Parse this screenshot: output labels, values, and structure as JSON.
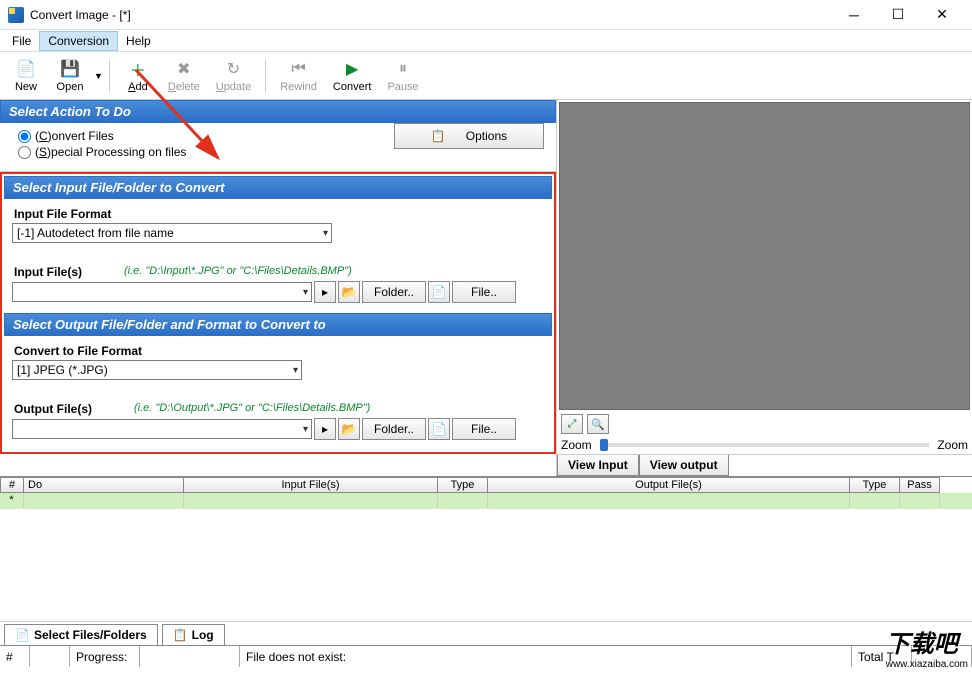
{
  "window": {
    "title": "Convert Image - [*]"
  },
  "menu": {
    "file": "File",
    "conversion": "Conversion",
    "help": "Help"
  },
  "toolbar": {
    "new": "New",
    "open": "Open",
    "add": "Add",
    "delete": "Delete",
    "update": "Update",
    "rewind": "Rewind",
    "convert": "Convert",
    "pause": "Pause"
  },
  "action": {
    "head": "Select Action To Do",
    "radio_convert": "onvert Files",
    "radio_special": "pecial Processing on files",
    "options": "Options"
  },
  "input_sec": {
    "head": "Select Input File/Folder to Convert",
    "format_label": "Input File Format",
    "format_value": "[-1] Autodetect from file name",
    "files_label": "Input File(s)",
    "hint": "(i.e. \"D:\\Input\\*.JPG\" or \"C:\\Files\\Details.BMP\")",
    "folder_btn": "Folder..",
    "file_btn": "File.."
  },
  "output_sec": {
    "head": "Select Output File/Folder and Format to Convert to",
    "format_label": "Convert to File Format",
    "format_value": "[1] JPEG (*.JPG)",
    "files_label": "Output File(s)",
    "hint": "(i.e. \"D:\\Output\\*.JPG\" or \"C:\\Files\\Details.BMP\")",
    "folder_btn": "Folder..",
    "file_btn": "File.."
  },
  "preview": {
    "zoom": "Zoom",
    "view_input": "View Input",
    "view_output": "View output"
  },
  "grid": {
    "hash": "#",
    "do": "Do",
    "input": "Input File(s)",
    "type": "Type",
    "output": "Output File(s)",
    "type2": "Type",
    "pass": "Pass",
    "row_mark": "*"
  },
  "tabs": {
    "select": "Select Files/Folders",
    "log": "Log"
  },
  "status": {
    "hash": "#",
    "progress": "Progress:",
    "msg": "File does not exist:",
    "total": "Total T"
  },
  "watermark": {
    "main": "下载吧",
    "sub": "www.xiazaiba.com"
  }
}
